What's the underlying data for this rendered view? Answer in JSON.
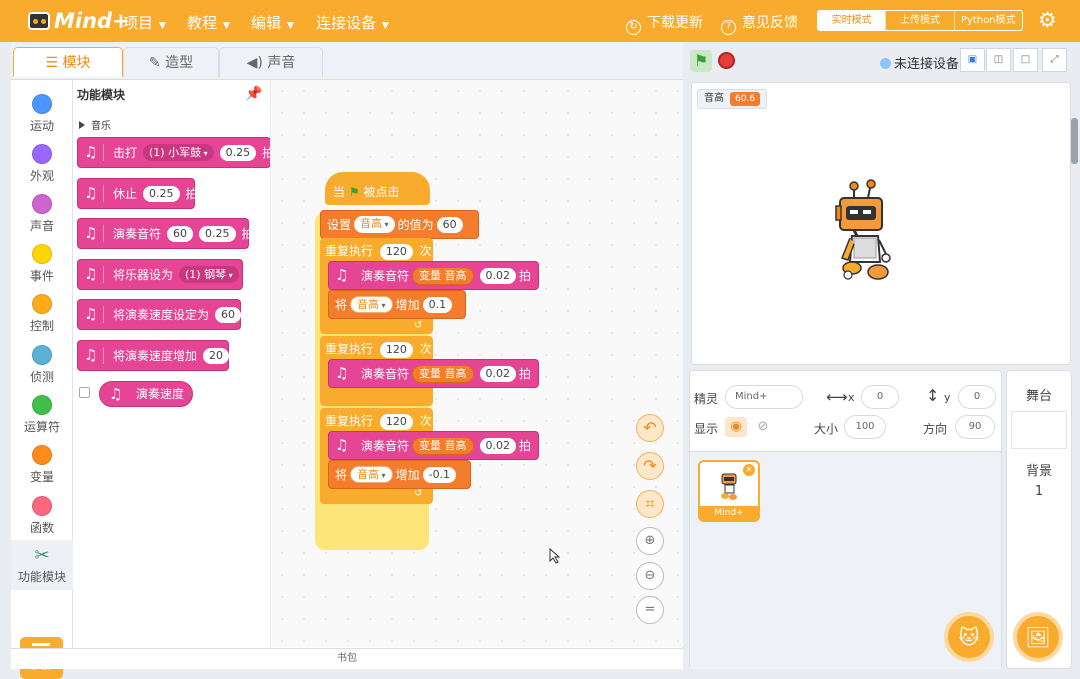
{
  "app": {
    "logo_text": "Mind+"
  },
  "menus": [
    "项目",
    "教程",
    "编辑",
    "连接设备"
  ],
  "top_right": {
    "update": "下载更新",
    "feedback": "意见反馈"
  },
  "modes": [
    "实时模式",
    "上传模式",
    "Python模式"
  ],
  "tabs": [
    "模块",
    "造型",
    "声音"
  ],
  "categories": [
    {
      "label": "运动",
      "color": "#4c97ff"
    },
    {
      "label": "外观",
      "color": "#9966ff"
    },
    {
      "label": "声音",
      "color": "#cf63cf"
    },
    {
      "label": "事件",
      "color": "#ffd500"
    },
    {
      "label": "控制",
      "color": "#ffab19"
    },
    {
      "label": "侦测",
      "color": "#5cb1d6"
    },
    {
      "label": "运算符",
      "color": "#40bf4a"
    },
    {
      "label": "变量",
      "color": "#ff8c1a"
    },
    {
      "label": "函数",
      "color": "#ff6680"
    },
    {
      "label": "功能模块",
      "color": "#3d8f6e"
    }
  ],
  "extension": "扩展",
  "palette": {
    "title": "功能模块",
    "section": "音乐",
    "b1": {
      "t1": "击打",
      "dd": "(1) 小军鼓",
      "v": "0.25",
      "t2": "拍"
    },
    "b2": {
      "t1": "休止",
      "v": "0.25",
      "t2": "拍"
    },
    "b3": {
      "t1": "演奏音符",
      "v1": "60",
      "v2": "0.25",
      "t2": "拍"
    },
    "b4": {
      "t1": "将乐器设为",
      "dd": "(1) 钢琴"
    },
    "b5": {
      "t1": "将演奏速度设定为",
      "v": "60"
    },
    "b6": {
      "t1": "将演奏速度增加",
      "v": "20"
    },
    "reporter": "演奏速度"
  },
  "script": {
    "hat_when": "当",
    "hat_clicked": "被点击",
    "set_label": "设置",
    "set_var": "音高",
    "set_value_of": "的值为",
    "set_value": "60",
    "repeat_label": "重复执行",
    "repeat_count": "120",
    "repeat_times": "次",
    "play_note": "演奏音符",
    "var_label": "变量",
    "var_name": "音高",
    "beats": "0.02",
    "beat_unit": "拍",
    "change_label": "将",
    "change_by": "增加",
    "change1": "0.1",
    "change2": "-0.1",
    "loop_arrow": "↺"
  },
  "canvas_buttons": {
    "zoom_reset": "="
  },
  "bottom_bar": "书包",
  "stage": {
    "connect_status": "未连接设备",
    "monitor_label": "音高",
    "monitor_value": "60.6"
  },
  "sprite": {
    "sprite_label": "精灵",
    "name": "Mind+",
    "x_label": "x",
    "x": "0",
    "y_label": "y",
    "y": "0",
    "show_label": "显示",
    "size_label": "大小",
    "size": "100",
    "direction_label": "方向",
    "direction": "90",
    "thumb_name": "Mind+"
  },
  "stage_panel": {
    "title": "舞台",
    "backdrop_label": "背景",
    "backdrop_count": "1"
  }
}
